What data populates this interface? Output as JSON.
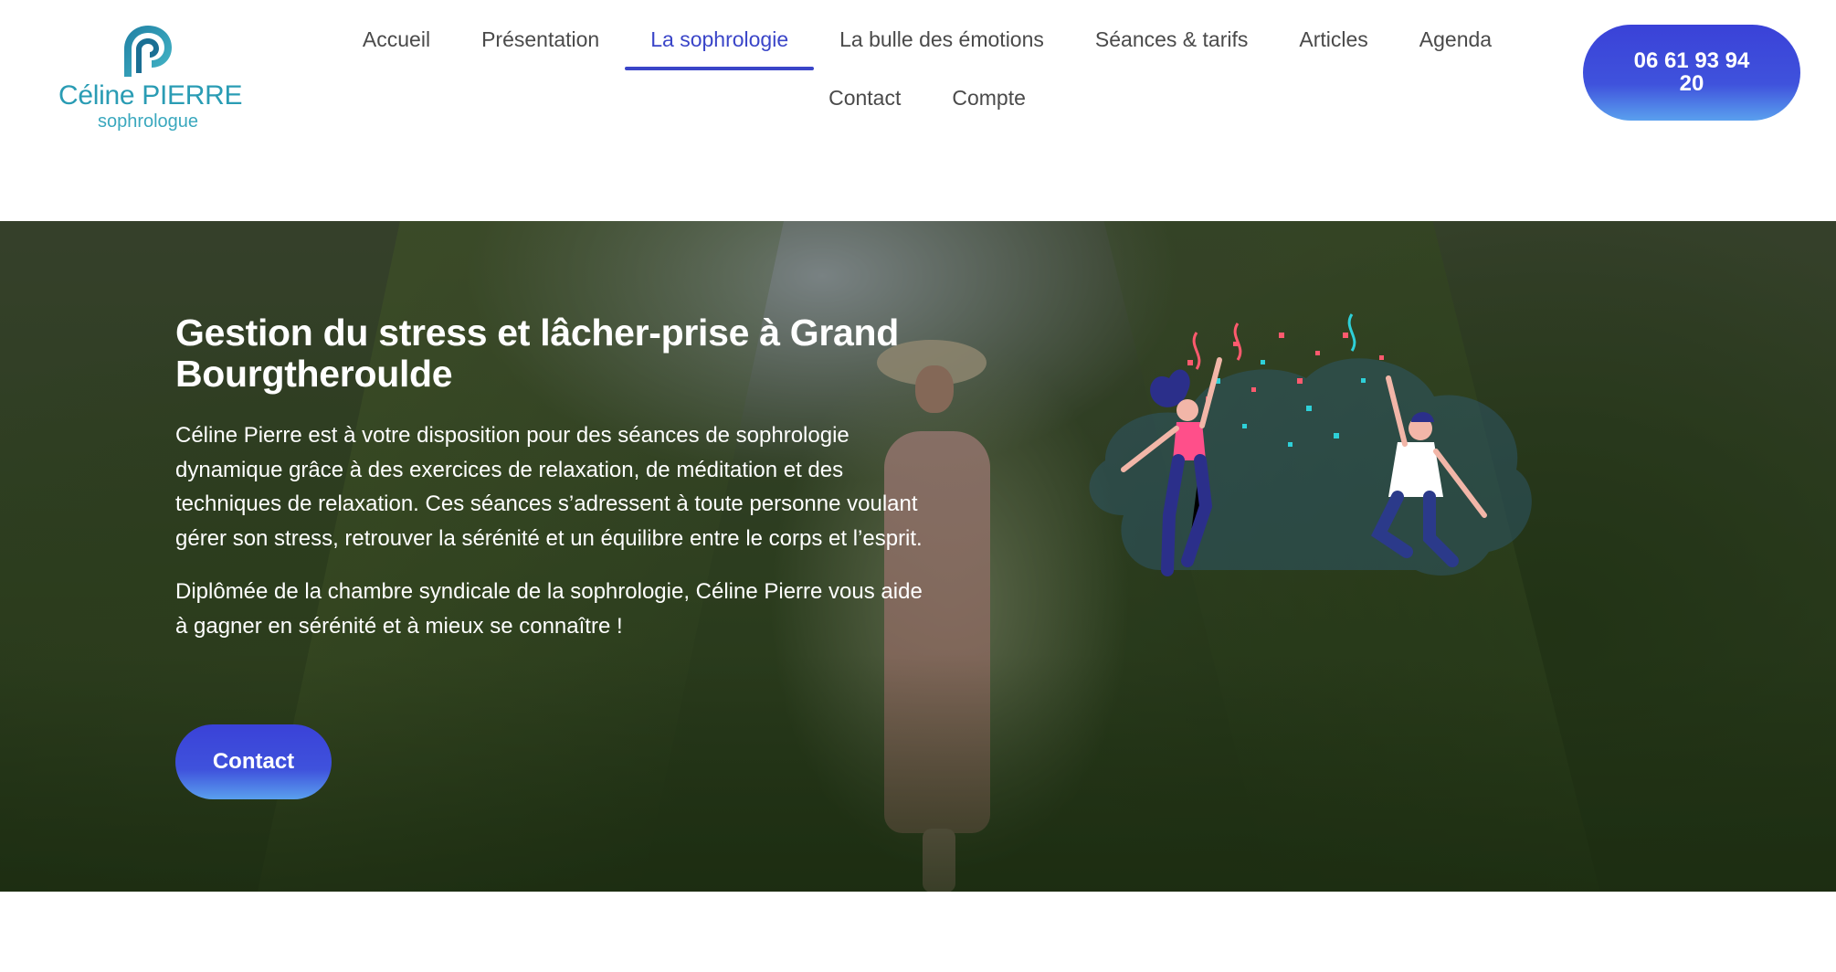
{
  "logo": {
    "name": "Céline PIERRE",
    "subtitle": "sophrologue"
  },
  "nav": {
    "row1": [
      {
        "label": "Accueil",
        "active": false
      },
      {
        "label": "Présentation",
        "active": false
      },
      {
        "label": "La sophrologie",
        "active": true
      },
      {
        "label": "La bulle des émotions",
        "active": false
      },
      {
        "label": "Séances & tarifs",
        "active": false
      },
      {
        "label": "Articles",
        "active": false
      },
      {
        "label": "Agenda",
        "active": false
      }
    ],
    "row2": [
      {
        "label": "Contact",
        "active": false
      },
      {
        "label": "Compte",
        "active": false
      }
    ]
  },
  "phone": {
    "line1": "06 61 93 94",
    "line2": "20"
  },
  "hero": {
    "title_line1": "Gestion du stress et lâcher-prise à Grand",
    "title_line2": "Bourgtheroulde",
    "paragraph1": "Céline Pierre est à votre disposition pour des séances de sophrologie dynamique grâce à des exercices de relaxation, de méditation et des techniques de relaxation. Ces séances s’adressent à toute personne voulant gérer son stress, retrouver la sérénité et un équilibre entre le corps et l’esprit.",
    "paragraph2": "Diplômée de la chambre syndicale de la sophrologie, Céline Pierre vous aide à gagner en sérénité et à mieux se connaître !",
    "cta_label": "Contact"
  },
  "colors": {
    "accent": "#3a45c8",
    "logo": "#2a9cb4",
    "button_top": "#3a42d8",
    "button_bottom": "#5aa0ee"
  },
  "icons": {
    "logo_mark": "logo-spiral-icon",
    "illustration": "celebrating-people-illustration"
  }
}
